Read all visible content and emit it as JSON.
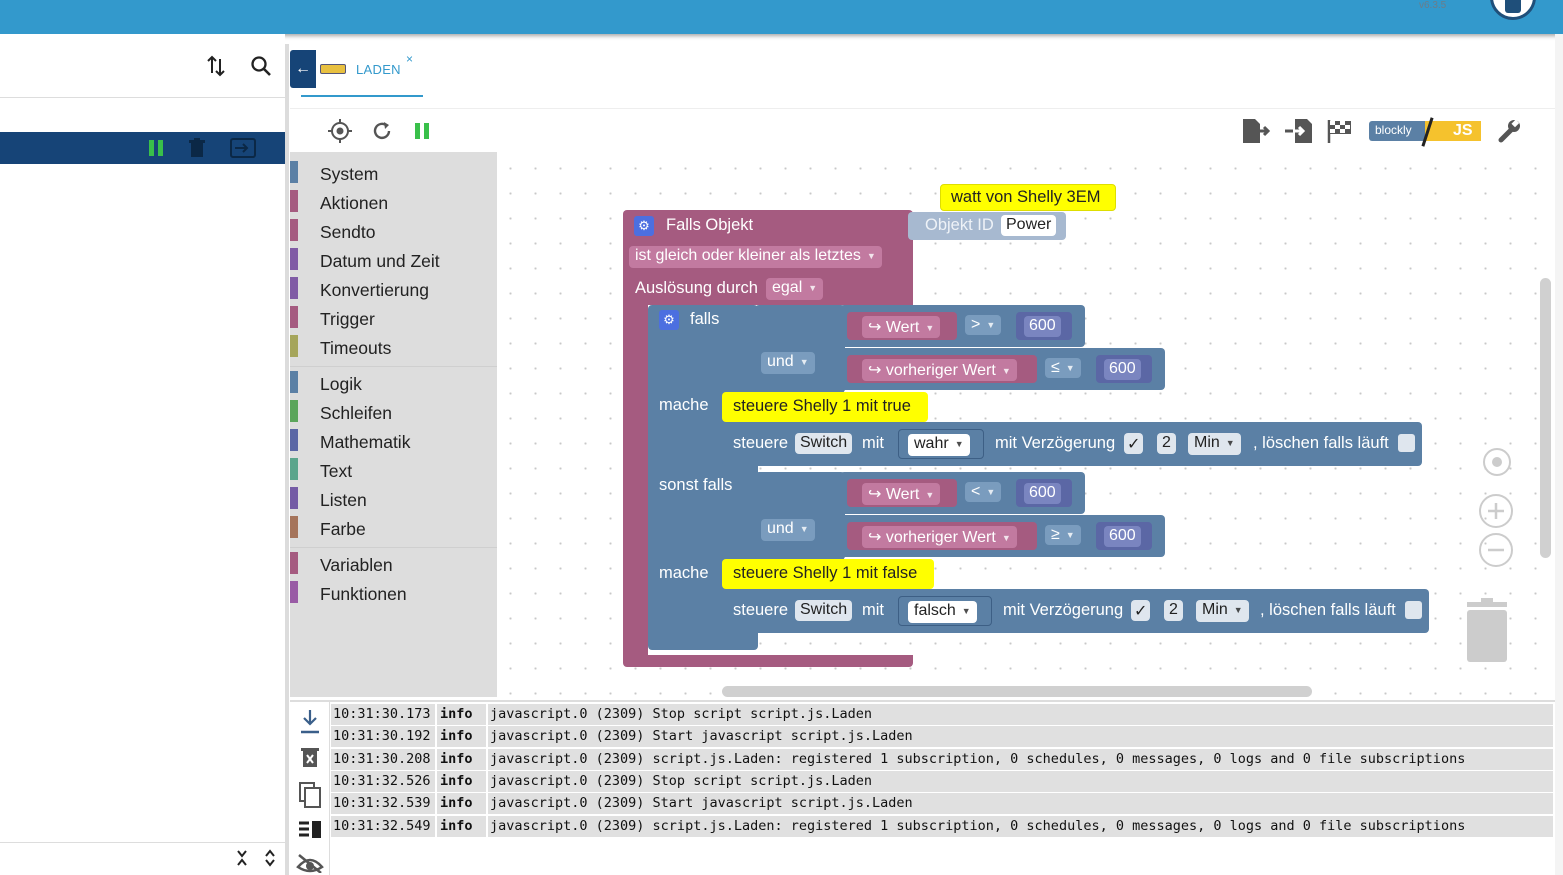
{
  "app": {
    "version": "v6.3.5"
  },
  "tab": {
    "label": "LADEN",
    "close": "×",
    "back": "←"
  },
  "toolbox": {
    "groups": [
      [
        {
          "label": "System",
          "color": "#5b80a5"
        },
        {
          "label": "Aktionen",
          "color": "#a55b80"
        },
        {
          "label": "Sendto",
          "color": "#a55b80"
        },
        {
          "label": "Datum und Zeit",
          "color": "#805ba5"
        },
        {
          "label": "Konvertierung",
          "color": "#805ba5"
        },
        {
          "label": "Trigger",
          "color": "#a55b80"
        },
        {
          "label": "Timeouts",
          "color": "#a5a55b"
        }
      ],
      [
        {
          "label": "Logik",
          "color": "#5b80a5"
        },
        {
          "label": "Schleifen",
          "color": "#5ba55b"
        },
        {
          "label": "Mathematik",
          "color": "#5b67a5"
        },
        {
          "label": "Text",
          "color": "#5ba58c"
        },
        {
          "label": "Listen",
          "color": "#745ba5"
        },
        {
          "label": "Farbe",
          "color": "#a5745b"
        }
      ],
      [
        {
          "label": "Variablen",
          "color": "#a55b80"
        },
        {
          "label": "Funktionen",
          "color": "#995ba5"
        }
      ]
    ]
  },
  "blocks": {
    "comment": "watt von Shelly 3EM",
    "trigger_label": "Falls Objekt",
    "object_id_label": "Objekt ID",
    "object_id_value": "Power",
    "condition": "ist gleich oder kleiner als letztes",
    "trigger_by_label": "Auslösung durch",
    "trigger_by_value": "egal",
    "if_label": "falls",
    "and_label": "und",
    "do_label": "mache",
    "elseif_label": "sonst falls",
    "value_label": "Wert",
    "prev_value_label": "vorheriger Wert",
    "arrow": "↪",
    "cmp_gt": ">",
    "cmp_le": "≤",
    "cmp_lt": "<",
    "cmp_ge": "≥",
    "num": "600",
    "note1": "steuere Shelly 1 mit true",
    "note2": "steuere Shelly 1 mit false",
    "control_label": "steuere",
    "control_target": "Switch",
    "with_label": "mit",
    "true_label": "wahr",
    "false_label": "falsch",
    "delay_label": "mit Verzögerung",
    "check": "✓",
    "delay_value": "2",
    "unit": "Min",
    "clear_label": ", löschen falls läuft"
  },
  "log": [
    {
      "time": "10:31:30.173",
      "level": "info",
      "msg": "javascript.0 (2309) Stop script script.js.Laden"
    },
    {
      "time": "10:31:30.192",
      "level": "info",
      "msg": "javascript.0 (2309) Start javascript script.js.Laden"
    },
    {
      "time": "10:31:30.208",
      "level": "info",
      "msg": "javascript.0 (2309) script.js.Laden: registered 1 subscription, 0 schedules, 0 messages, 0 logs and 0 file subscriptions"
    },
    {
      "time": "10:31:32.526",
      "level": "info",
      "msg": "javascript.0 (2309) Stop script script.js.Laden"
    },
    {
      "time": "10:31:32.539",
      "level": "info",
      "msg": "javascript.0 (2309) Start javascript script.js.Laden"
    },
    {
      "time": "10:31:32.549",
      "level": "info",
      "msg": "javascript.0 (2309) script.js.Laden: registered 1 subscription, 0 schedules, 0 messages, 0 logs and 0 file subscriptions"
    }
  ],
  "toolbar": {
    "blockly_label": "blockly",
    "js_label": "JS"
  },
  "colors": {
    "event": "#a55b80",
    "logic": "#5b80a5",
    "comment": "#ffff00",
    "header": "#3399cc"
  }
}
